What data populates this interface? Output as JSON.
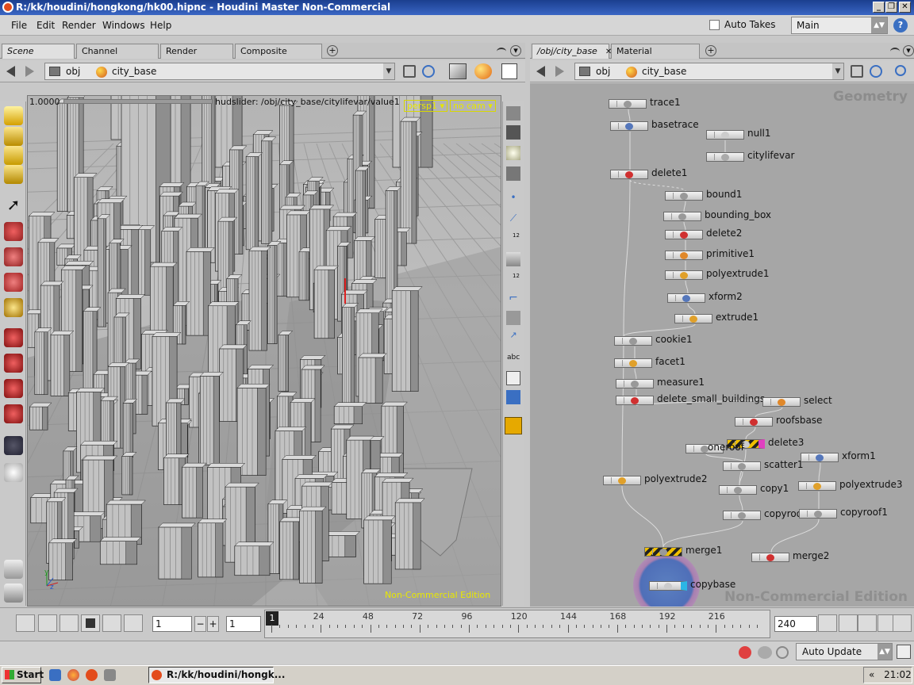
{
  "window": {
    "title": "R:/kk/houdini/hongkong/hk00.hipnc - Houdini Master Non-Commercial"
  },
  "menu": [
    "File",
    "Edit",
    "Render",
    "Windows",
    "Help"
  ],
  "auto_takes_label": "Auto Takes",
  "desktop_select": "Main",
  "left_tabs": [
    "Scene View",
    "Channel Editor",
    "Render View",
    "Composite View"
  ],
  "right_tabs": [
    "/obj/city_base",
    "Material Palette"
  ],
  "left_path": [
    "obj",
    "city_base"
  ],
  "right_path": [
    "obj",
    "city_base"
  ],
  "viewport": {
    "value": "1.0000",
    "hud_slider": "hudslider: /obj/city_base/citylifevar/value1",
    "camera": "persp1",
    "cam_option": "no cam",
    "nc_label": "Non-Commercial Edition",
    "strip_numbers": [
      "12",
      "12",
      "abc"
    ]
  },
  "network": {
    "context": "Geometry",
    "nc_label": "Non-Commercial Edition",
    "nodes": [
      {
        "name": "trace1"
      },
      {
        "name": "basetrace"
      },
      {
        "name": "null1"
      },
      {
        "name": "citylifevar"
      },
      {
        "name": "delete1"
      },
      {
        "name": "bound1"
      },
      {
        "name": "bounding_box"
      },
      {
        "name": "delete2"
      },
      {
        "name": "primitive1"
      },
      {
        "name": "polyextrude1"
      },
      {
        "name": "xform2"
      },
      {
        "name": "extrude1"
      },
      {
        "name": "cookie1"
      },
      {
        "name": "facet1"
      },
      {
        "name": "measure1"
      },
      {
        "name": "delete_small_buildings"
      },
      {
        "name": "select"
      },
      {
        "name": "roofsbase"
      },
      {
        "name": "delete3"
      },
      {
        "name": "oneroof"
      },
      {
        "name": "scatter1"
      },
      {
        "name": "xform1"
      },
      {
        "name": "polyextrude2"
      },
      {
        "name": "copy1"
      },
      {
        "name": "polyextrude3"
      },
      {
        "name": "copyroof"
      },
      {
        "name": "copyroof1"
      },
      {
        "name": "merge1"
      },
      {
        "name": "merge2"
      },
      {
        "name": "copybase"
      }
    ]
  },
  "timeline": {
    "current_frame": "1",
    "step": "1",
    "end_frame": "240",
    "playhead": "1",
    "ticks": [
      "24",
      "48",
      "72",
      "96",
      "120",
      "144",
      "168",
      "192",
      "216"
    ]
  },
  "status": {
    "auto_update": "Auto Update"
  },
  "taskbar": {
    "start": "Start",
    "task": "R:/kk/houdini/hongk...",
    "clock": "21:02",
    "tray_arrows": "«"
  },
  "colors": {
    "titlebar": "#2a52a8",
    "viewport_bg": "#b4b4b4",
    "network_bg": "#a6a6a6",
    "hud_yellow": "#e6e600",
    "copybase_blue": "#4f6fb8"
  }
}
